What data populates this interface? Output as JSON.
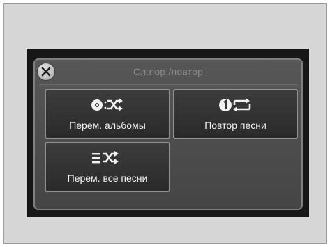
{
  "dialog": {
    "title": "Сл.пор./повтор"
  },
  "buttons": {
    "albums": {
      "label": "Перем. альбомы",
      "icon": "disc-shuffle-icon"
    },
    "repeat_song": {
      "label": "Повтор песни",
      "icon": "repeat-one-icon"
    },
    "all_songs": {
      "label": "Перем. все песни",
      "icon": "list-shuffle-icon"
    }
  },
  "colors": {
    "panel": "#4e4e4e",
    "button": "#333333",
    "border": "#909090",
    "text": "#f2f2f2"
  }
}
